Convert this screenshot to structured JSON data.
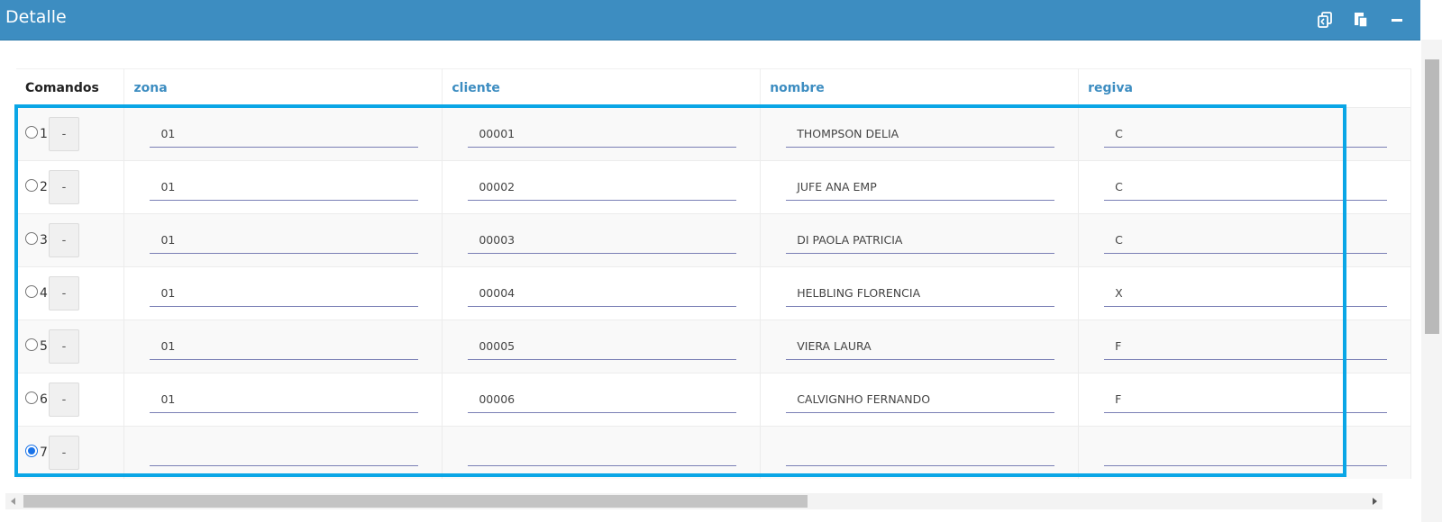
{
  "panel": {
    "title": "Detalle"
  },
  "header_icons": [
    "copy-icon",
    "paste-icon",
    "minimize-icon"
  ],
  "columns": {
    "commands": "Comandos",
    "zona": "zona",
    "cliente": "cliente",
    "nombre": "nombre",
    "regiva": "regiva"
  },
  "dash_label": "-",
  "rows": [
    {
      "num": "1",
      "zona": "01",
      "cliente": "00001",
      "nombre": "THOMPSON DELIA",
      "regiva": "C",
      "selected": false
    },
    {
      "num": "2",
      "zona": "01",
      "cliente": "00002",
      "nombre": "JUFE ANA EMP",
      "regiva": "C",
      "selected": false
    },
    {
      "num": "3",
      "zona": "01",
      "cliente": "00003",
      "nombre": "DI PAOLA PATRICIA",
      "regiva": "C",
      "selected": false
    },
    {
      "num": "4",
      "zona": "01",
      "cliente": "00004",
      "nombre": "HELBLING FLORENCIA",
      "regiva": "X",
      "selected": false
    },
    {
      "num": "5",
      "zona": "01",
      "cliente": "00005",
      "nombre": "VIERA LAURA",
      "regiva": "F",
      "selected": false
    },
    {
      "num": "6",
      "zona": "01",
      "cliente": "00006",
      "nombre": "CALVIGNHO FERNANDO",
      "regiva": "F",
      "selected": false
    },
    {
      "num": "7",
      "zona": "",
      "cliente": "",
      "nombre": "",
      "regiva": "",
      "selected": true
    }
  ],
  "colors": {
    "header": "#3d8dc1",
    "highlight": "#0aa6e6",
    "column_header": "#3d8dc1"
  }
}
